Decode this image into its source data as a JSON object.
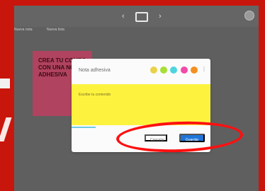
{
  "toolbar": {
    "nav_left": "‹",
    "nav_right": "›",
    "icons": {
      "nav_left": "chevron-left-icon",
      "document": "document-icon",
      "nav_right": "chevron-right-icon",
      "avatar": "avatar-icon"
    }
  },
  "subnav": {
    "link1": "Nueva nota",
    "link2": "Nueva lista"
  },
  "sticky": {
    "text": "CREA TU COMPO CON UNA NOTA ADHESIVA"
  },
  "dialog": {
    "title": "Nota adhesiva",
    "colors": [
      "#e9d24b",
      "#a7df34",
      "#4fd4df",
      "#f24aa8",
      "#f58f22"
    ],
    "more_icon": "⋮",
    "editor_placeholder": "Escribe tu contenido",
    "cancel": "Cancelar",
    "save": "Guardar"
  },
  "annotation": {
    "color": "#ff1010"
  }
}
